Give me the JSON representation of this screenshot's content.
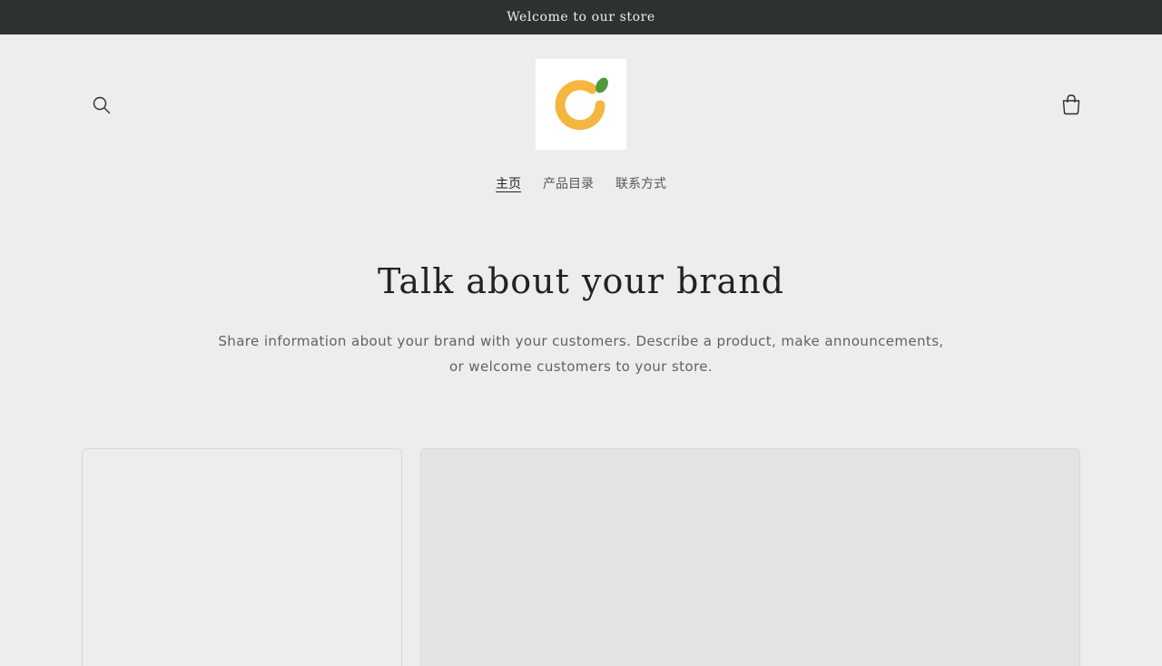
{
  "announcement": {
    "text": "Welcome to our store"
  },
  "header": {
    "search_icon": "search-icon",
    "cart_icon": "cart-icon",
    "logo": {
      "name": "store-logo",
      "colors": {
        "ring": "#f6b53f",
        "leaf": "#4c9a3a",
        "background": "#ffffff"
      }
    }
  },
  "nav": {
    "items": [
      {
        "label": "主页",
        "active": true
      },
      {
        "label": "产品目录",
        "active": false
      },
      {
        "label": "联系方式",
        "active": false
      }
    ]
  },
  "hero": {
    "title": "Talk about your brand",
    "description": "Share information about your brand with your customers. Describe a product, make announcements, or welcome customers to your store."
  },
  "colors": {
    "page_background": "#eeedeb",
    "announcement_background": "#2c3330",
    "text_primary": "#1f2422"
  }
}
